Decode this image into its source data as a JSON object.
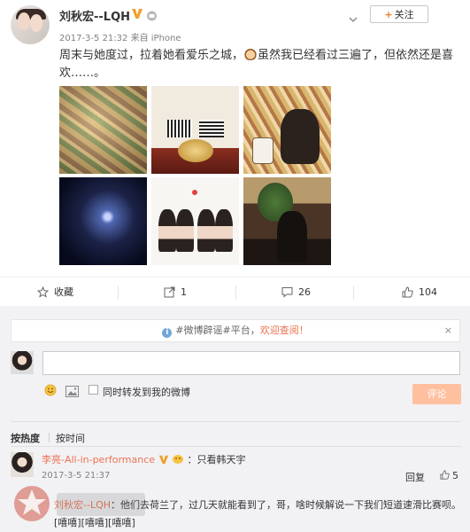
{
  "post": {
    "author": "刘秋宏--LQH",
    "time": "2017-3-5 21:32",
    "source": "来自 iPhone",
    "follow_label": "关注",
    "follow_plus": "+",
    "text_part1": "周末与她度过，拉着她看爱乐之城，",
    "text_part2": "虽然我已经看过三遍了，但依然还是喜欢……。"
  },
  "actions": {
    "favorite": "收藏",
    "repost": "1",
    "comments": "26",
    "likes": "104"
  },
  "notice": {
    "part1": "#微博辟谣#平台，",
    "part2": "欢迎查阅！",
    "close": "×"
  },
  "composer": {
    "also_repost": "同时转发到我的微博",
    "submit": "评论"
  },
  "sort": {
    "hot": "按热度",
    "time": "按时间"
  },
  "comment": {
    "user": "李亮-All-in-performance",
    "text": "：只看韩天宇",
    "time": "2017-3-5 21:37",
    "reply": "回复",
    "likes": "5"
  },
  "subreply": {
    "user": "刘秋宏--LQH",
    "text": "：他们去荷兰了，过几天就能看到了，哥，啥时候解说一下我们短道速滑比赛呗。[嘻嘻][嘻嘻][嘻嘻]"
  },
  "colors": {
    "accent": "#eb7350",
    "vbadge": "#f0a02c",
    "submit_bg": "#ffc09f"
  }
}
